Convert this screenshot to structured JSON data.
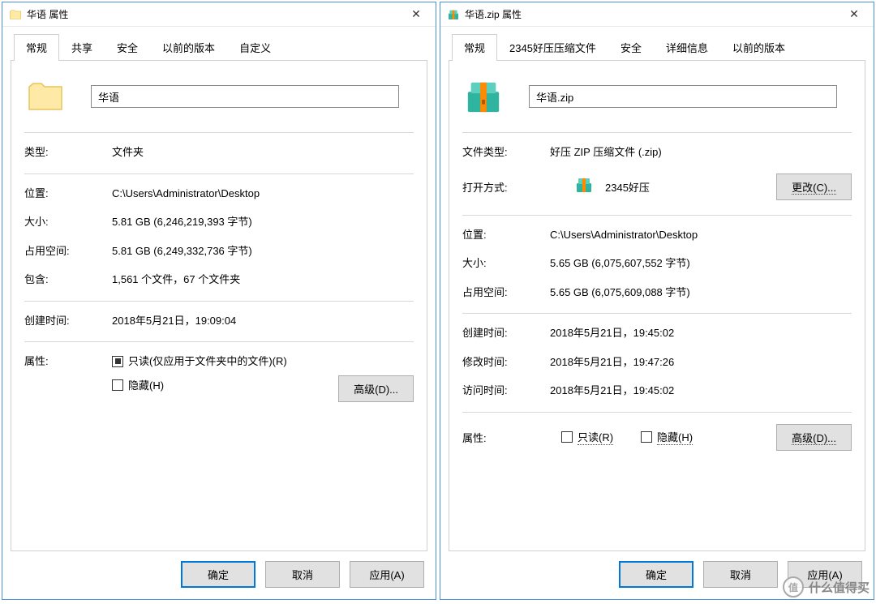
{
  "left": {
    "title": "华语 属性",
    "tabs": [
      "常规",
      "共享",
      "安全",
      "以前的版本",
      "自定义"
    ],
    "active_tab": 0,
    "filename": "华语",
    "rows": {
      "type_label": "类型:",
      "type_value": "文件夹",
      "location_label": "位置:",
      "location_value": "C:\\Users\\Administrator\\Desktop",
      "size_label": "大小:",
      "size_value": "5.81 GB (6,246,219,393 字节)",
      "sizeondisk_label": "占用空间:",
      "sizeondisk_value": "5.81 GB (6,249,332,736 字节)",
      "contains_label": "包含:",
      "contains_value": "1,561 个文件，67 个文件夹",
      "created_label": "创建时间:",
      "created_value": "2018年5月21日，19:09:04",
      "attrs_label": "属性:",
      "readonly_label": "只读(仅应用于文件夹中的文件)(R)",
      "hidden_label": "隐藏(H)"
    },
    "buttons": {
      "advanced": "高级(D)...",
      "ok": "确定",
      "cancel": "取消",
      "apply": "应用(A)"
    }
  },
  "right": {
    "title": "华语.zip 属性",
    "tabs": [
      "常规",
      "2345好压压缩文件",
      "安全",
      "详细信息",
      "以前的版本"
    ],
    "active_tab": 0,
    "filename": "华语.zip",
    "rows": {
      "filetype_label": "文件类型:",
      "filetype_value": "好压 ZIP 压缩文件 (.zip)",
      "openwith_label": "打开方式:",
      "openwith_value": "2345好压",
      "location_label": "位置:",
      "location_value": "C:\\Users\\Administrator\\Desktop",
      "size_label": "大小:",
      "size_value": "5.65 GB (6,075,607,552 字节)",
      "sizeondisk_label": "占用空间:",
      "sizeondisk_value": "5.65 GB (6,075,609,088 字节)",
      "created_label": "创建时间:",
      "created_value": "2018年5月21日，19:45:02",
      "modified_label": "修改时间:",
      "modified_value": "2018年5月21日，19:47:26",
      "accessed_label": "访问时间:",
      "accessed_value": "2018年5月21日，19:45:02",
      "attrs_label": "属性:",
      "readonly_label": "只读(R)",
      "hidden_label": "隐藏(H)"
    },
    "buttons": {
      "change": "更改(C)...",
      "advanced": "高级(D)...",
      "ok": "确定",
      "cancel": "取消",
      "apply": "应用(A)"
    }
  },
  "watermark": "什么值得买"
}
